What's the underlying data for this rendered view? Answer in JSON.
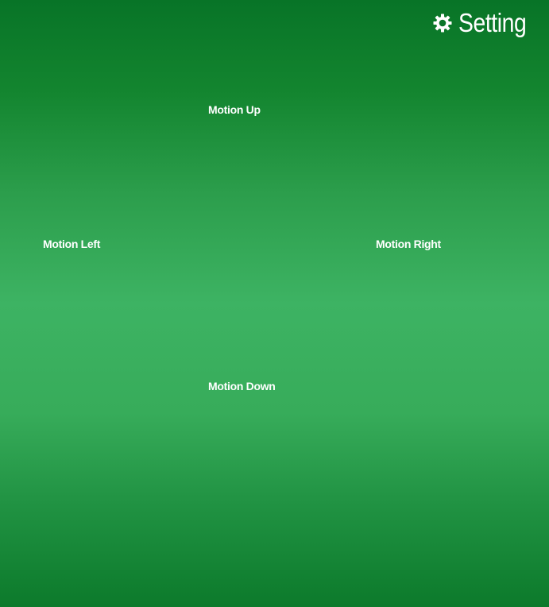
{
  "header": {
    "setting_label": "Setting",
    "setting_icon": "gear-icon"
  },
  "motion": {
    "up_label": "Motion Up",
    "left_label": "Motion Left",
    "right_label": "Motion Right",
    "down_label": "Motion Down"
  },
  "theme": {
    "background_dark": "#087427",
    "background_light": "#3db363",
    "text_color": "#ffffff"
  }
}
